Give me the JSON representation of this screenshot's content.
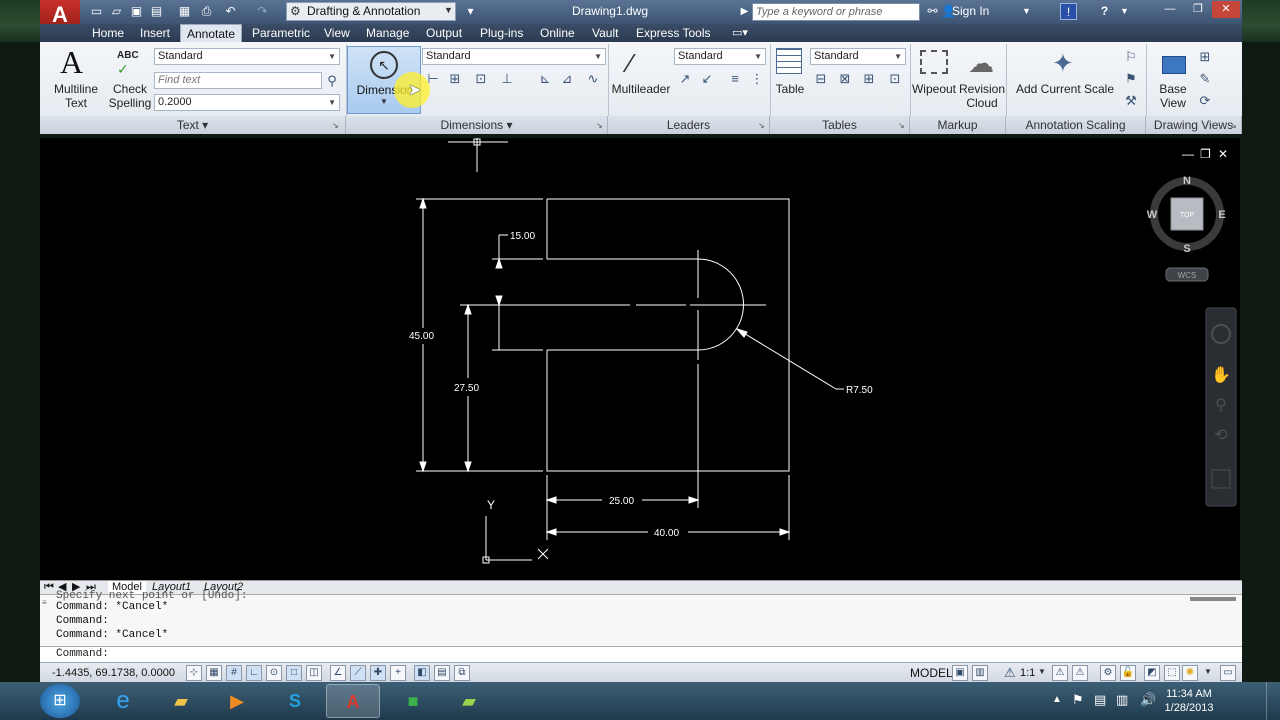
{
  "title_bar": {
    "workspace": "Drafting & Annotation",
    "document": "Drawing1.dwg",
    "search_placeholder": "Type a keyword or phrase",
    "sign_in": "Sign In"
  },
  "ribbon_tabs": [
    "Home",
    "Insert",
    "Annotate",
    "Parametric",
    "View",
    "Manage",
    "Output",
    "Plug-ins",
    "Online",
    "Vault",
    "Express Tools"
  ],
  "active_tab": "Annotate",
  "text_panel": {
    "multiline_text": "Multiline Text",
    "check_spelling": "Check Spelling",
    "style": "Standard",
    "find_placeholder": "Find text",
    "height": "0.2000",
    "title": "Text"
  },
  "dimensions_panel": {
    "button": "Dimension",
    "style": "Standard",
    "title": "Dimensions"
  },
  "leaders_panel": {
    "button": "Multileader",
    "style": "Standard",
    "title": "Leaders"
  },
  "tables_panel": {
    "button": "Table",
    "style": "Standard",
    "title": "Tables"
  },
  "markup_panel": {
    "wipeout": "Wipeout",
    "revision_cloud": "Revision Cloud",
    "title": "Markup"
  },
  "annotation_scaling_panel": {
    "button": "Add Current Scale",
    "title": "Annotation Scaling"
  },
  "drawing_views_panel": {
    "button": "Base View",
    "title": "Drawing Views"
  },
  "viewcube": {
    "north": "N",
    "south": "S",
    "east": "E",
    "west": "W",
    "face": "TOP",
    "ucs": "WCS"
  },
  "drawing": {
    "dim_15": "15.00",
    "dim_45": "45.00",
    "dim_27_5": "27.50",
    "dim_25": "25.00",
    "dim_40": "40.00",
    "radius": "R7.50",
    "ucs_x": "X",
    "ucs_y": "Y"
  },
  "layout_tabs": [
    "Model",
    "Layout1",
    "Layout2"
  ],
  "command_history": [
    "Specify next point or [Undo]:",
    "Command: *Cancel*",
    "Command:",
    "Command: *Cancel*"
  ],
  "command_prompt": "Command:",
  "status": {
    "coordinates": "-1.4435, 69.1738, 0.0000",
    "model": "MODEL",
    "scale": "1:1"
  },
  "taskbar": {
    "time": "11:34 AM",
    "date": "1/28/2013"
  }
}
